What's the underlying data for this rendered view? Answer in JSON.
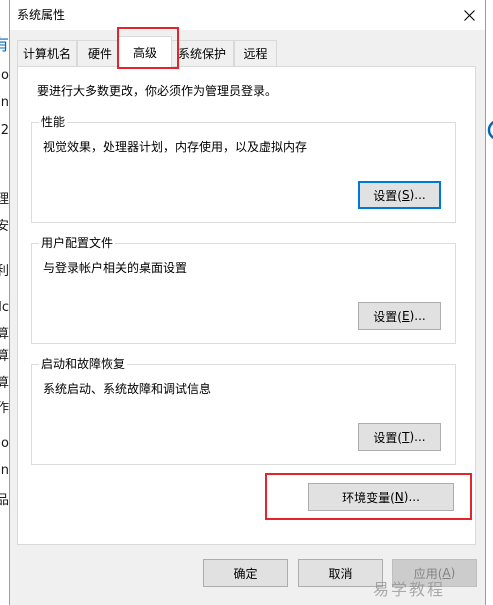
{
  "window": {
    "title": "系统属性"
  },
  "icons": {
    "close": "close-icon",
    "background_partial": "partial-circle-icon"
  },
  "tabs": [
    {
      "label": "计算机名",
      "selected": false
    },
    {
      "label": "硬件",
      "selected": false
    },
    {
      "label": "高级",
      "selected": true
    },
    {
      "label": "系统保护",
      "selected": false
    },
    {
      "label": "远程",
      "selected": false
    }
  ],
  "panel": {
    "admin_notice": "要进行大多数更改，你必须作为管理员登录。",
    "groups": [
      {
        "title": "性能",
        "description": "视觉效果，处理器计划，内存使用，以及虚拟内存",
        "button": "设置(S)..."
      },
      {
        "title": "用户配置文件",
        "description": "与登录帐户相关的桌面设置",
        "button": "设置(E)..."
      },
      {
        "title": "启动和故障恢复",
        "description": "系统启动、系统故障和调试信息",
        "button": "设置(T)..."
      }
    ],
    "env_button": "环境变量(N)..."
  },
  "footer": {
    "ok": "确定",
    "cancel": "取消",
    "apply": "应用(A)"
  },
  "watermark": "易学教程",
  "background_window": {
    "left_fragments": [
      "有",
      "o",
      "in",
      "2",
      "理",
      "安",
      "利",
      "lc",
      "算",
      "算",
      "算",
      "作",
      "o",
      "in",
      "品"
    ]
  },
  "colors": {
    "highlight_box": "#e4242a",
    "focus_accent": "#0078d7",
    "background_accent": "#0067c0"
  }
}
